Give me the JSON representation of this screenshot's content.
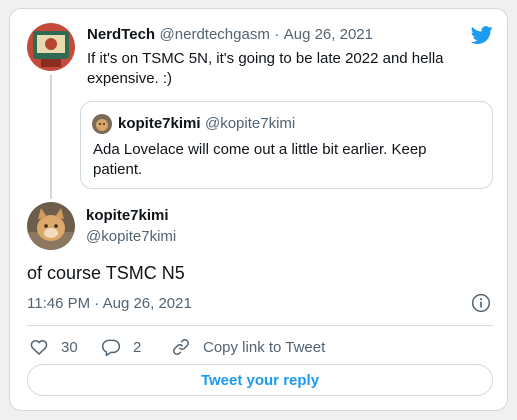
{
  "parent_tweet": {
    "name": "NerdTech",
    "handle": "@nerdtechgasm",
    "separator": "·",
    "date": "Aug 26, 2021",
    "text": "If it's on TSMC 5N, it's going to be late 2022 and hella expensive. :)"
  },
  "quoted_tweet": {
    "name": "kopite7kimi",
    "handle": "@kopite7kimi",
    "text": "Ada Lovelace will come out a little bit earlier. Keep patient."
  },
  "main_tweet": {
    "name": "kopite7kimi",
    "handle": "@kopite7kimi",
    "text": "of course TSMC N5",
    "timestamp": "11:46 PM · Aug 26, 2021"
  },
  "actions": {
    "likes": "30",
    "replies": "2",
    "copy_link_label": "Copy link to Tweet"
  },
  "reply_button_label": "Tweet your reply",
  "colors": {
    "brand": "#1d9bf0",
    "text": "#0f1419",
    "muted": "#536471",
    "border": "#cfd9de"
  },
  "icons": [
    "twitter-bird-icon",
    "info-icon",
    "heart-icon",
    "reply-bubble-icon",
    "link-icon"
  ]
}
